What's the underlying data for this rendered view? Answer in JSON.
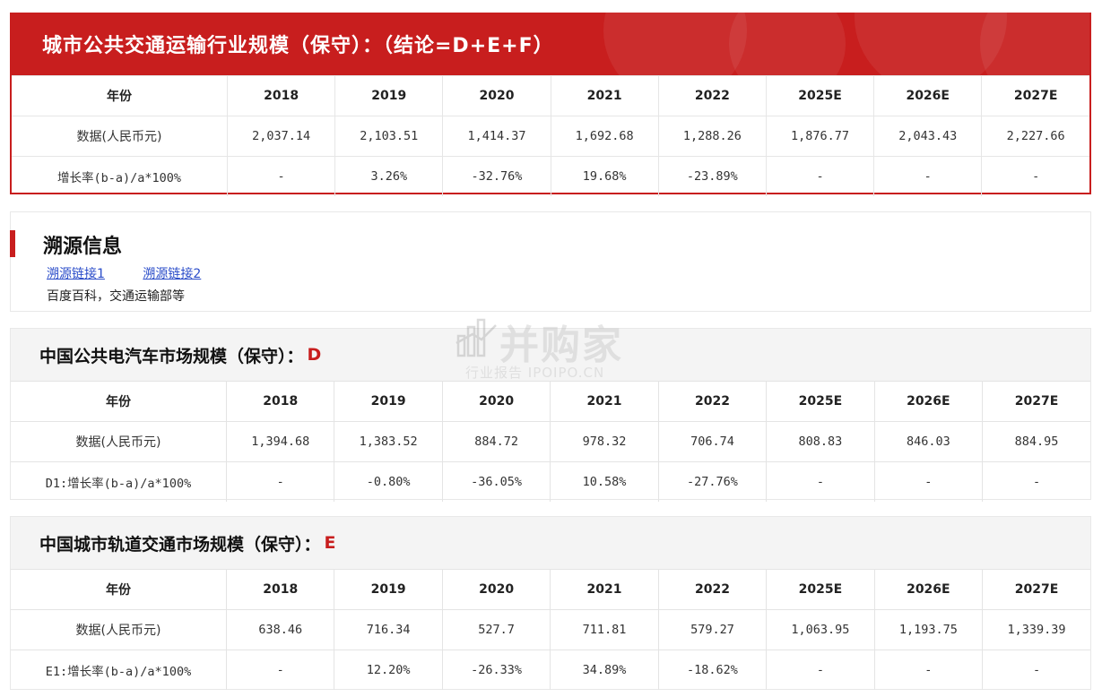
{
  "main": {
    "title": "城市公共交通运输行业规模（保守）：（结论=D+E+F）",
    "header_row": [
      "年份",
      "2018",
      "2019",
      "2020",
      "2021",
      "2022",
      "2025E",
      "2026E",
      "2027E"
    ],
    "data_row": [
      "数据(人民币元)",
      "2,037.14",
      "2,103.51",
      "1,414.37",
      "1,692.68",
      "1,288.26",
      "1,876.77",
      "2,043.43",
      "2,227.66"
    ],
    "growth_row": [
      "增长率(b-a)/a*100%",
      "-",
      "3.26%",
      "-32.76%",
      "19.68%",
      "-23.89%",
      "-",
      "-",
      "-"
    ]
  },
  "trace": {
    "title": "溯源信息",
    "link1": "溯源链接1",
    "link2": "溯源链接2",
    "source": "百度百科，交通运输部等"
  },
  "section_d": {
    "title": "中国公共电汽车市场规模（保守）：",
    "tag": "D",
    "header_row": [
      "年份",
      "2018",
      "2019",
      "2020",
      "2021",
      "2022",
      "2025E",
      "2026E",
      "2027E"
    ],
    "data_row": [
      "数据(人民币元)",
      "1,394.68",
      "1,383.52",
      "884.72",
      "978.32",
      "706.74",
      "808.83",
      "846.03",
      "884.95"
    ],
    "growth_row": [
      "D1:增长率(b-a)/a*100%",
      "-",
      "-0.80%",
      "-36.05%",
      "10.58%",
      "-27.76%",
      "-",
      "-",
      "-"
    ]
  },
  "section_e": {
    "title": "中国城市轨道交通市场规模（保守）：",
    "tag": "E",
    "header_row": [
      "年份",
      "2018",
      "2019",
      "2020",
      "2021",
      "2022",
      "2025E",
      "2026E",
      "2027E"
    ],
    "data_row": [
      "数据(人民币元)",
      "638.46",
      "716.34",
      "527.7",
      "711.81",
      "579.27",
      "1,063.95",
      "1,193.75",
      "1,339.39"
    ],
    "growth_row": [
      "E1:增长率(b-a)/a*100%",
      "-",
      "12.20%",
      "-26.33%",
      "34.89%",
      "-18.62%",
      "-",
      "-",
      "-"
    ]
  },
  "watermark": {
    "brand": "并购家",
    "sub": "行业报告 IPOIPO.CN"
  },
  "colors": {
    "accent": "#c81e1e",
    "link": "#2a4cc9",
    "gray_header": "#f4f4f4"
  }
}
